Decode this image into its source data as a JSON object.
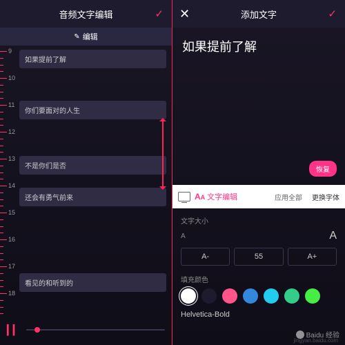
{
  "left": {
    "title": "音频文字编辑",
    "edit_label": "编辑",
    "lyrics": [
      {
        "t": 9,
        "text": "如果提前了解"
      },
      {
        "t": 11,
        "text": "你们要面对的人生"
      },
      {
        "t": 13,
        "text": "不是你们是否"
      },
      {
        "t": 14,
        "text": "还会有勇气前来"
      },
      {
        "t": 17,
        "text": "看见的和听到的"
      }
    ],
    "ruler_marks": [
      "9",
      "10",
      "11",
      "12",
      "13",
      "14",
      "15",
      "16",
      "17",
      "18"
    ]
  },
  "right": {
    "title": "添加文字",
    "preview_text": "如果提前了解",
    "restore": "恢复",
    "tab_edit": "文字编辑",
    "apply_all": "应用全部",
    "change_font": "更换字体",
    "size_label": "文字大小",
    "size_minus": "A-",
    "size_value": "55",
    "size_plus": "A+",
    "color_label": "填充颜色",
    "colors": [
      "#ffffff",
      "#1e1b2e",
      "#ff5588",
      "#3388dd",
      "#22ccee",
      "#33cc88",
      "#44ee44"
    ],
    "font_name": "Helvetica-Bold"
  },
  "watermark": {
    "brand": "Baidu 经验",
    "url": "jingyan.baidu.com"
  }
}
